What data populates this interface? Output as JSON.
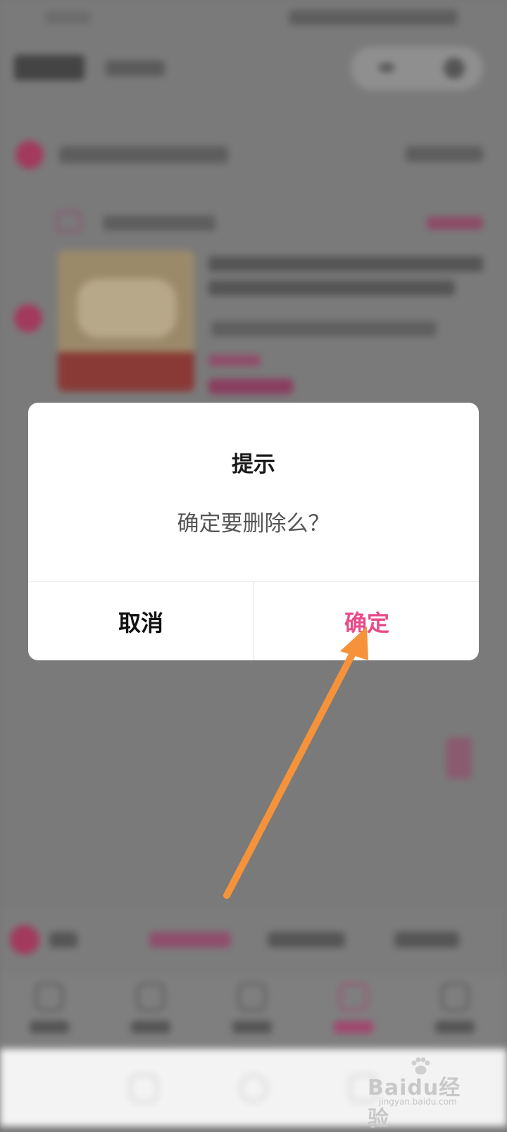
{
  "dialog": {
    "title": "提示",
    "message": "确定要删除么？",
    "cancel_label": "取消",
    "confirm_label": "确定"
  },
  "watermark": {
    "logo": "Baidu经验",
    "url": "jingyan.baidu.com"
  },
  "colors": {
    "accent": "#e84a8a",
    "arrow": "#f5923a",
    "overlay": "#7a7a7a"
  }
}
